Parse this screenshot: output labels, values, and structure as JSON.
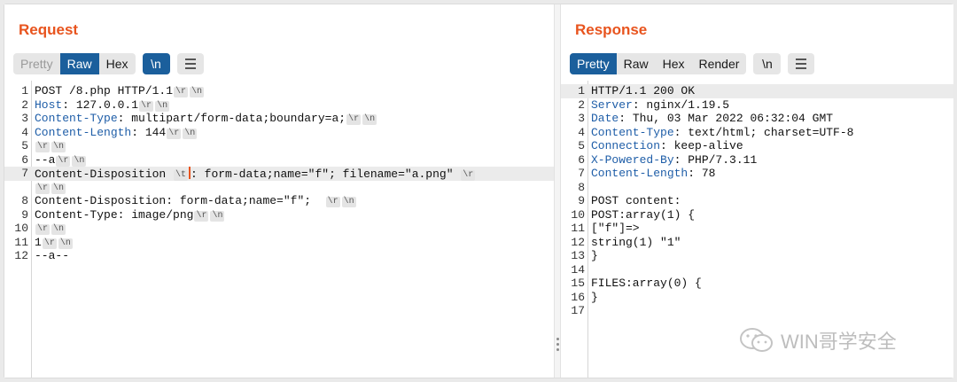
{
  "request": {
    "title": "Request",
    "tabs": [
      "Pretty",
      "Raw",
      "Hex"
    ],
    "active_tab": "Raw",
    "newline_button": "\\n",
    "lines": [
      {
        "n": "1",
        "segs": [
          {
            "t": "POST /8.php HTTP/1.1"
          },
          {
            "tag": "\\r"
          },
          {
            "tag": "\\n"
          }
        ]
      },
      {
        "n": "2",
        "segs": [
          {
            "k": "Host"
          },
          {
            "t": ": 127.0.0.1"
          },
          {
            "tag": "\\r"
          },
          {
            "tag": "\\n"
          }
        ]
      },
      {
        "n": "3",
        "segs": [
          {
            "k": "Content-Type"
          },
          {
            "t": ": multipart/form-data;boundary=a;"
          },
          {
            "tag": "\\r"
          },
          {
            "tag": "\\n"
          }
        ]
      },
      {
        "n": "4",
        "segs": [
          {
            "k": "Content-Length"
          },
          {
            "t": ": 144"
          },
          {
            "tag": "\\r"
          },
          {
            "tag": "\\n"
          }
        ]
      },
      {
        "n": "5",
        "segs": [
          {
            "tag": "\\r"
          },
          {
            "tag": "\\n"
          }
        ]
      },
      {
        "n": "6",
        "segs": [
          {
            "t": "--a"
          },
          {
            "tag": "\\r"
          },
          {
            "tag": "\\n"
          }
        ]
      },
      {
        "n": "7",
        "hl": true,
        "segs": [
          {
            "t": "Content-Disposition "
          },
          {
            "tag": "\\t"
          },
          {
            "caret": true
          },
          {
            "t": ": form-data;name=\"f\"; filename=\"a.png\" "
          },
          {
            "tag": "\\r"
          }
        ]
      },
      {
        "n": "",
        "hl": false,
        "segs": [
          {
            "tag": "\\r"
          },
          {
            "tag": "\\n"
          }
        ]
      },
      {
        "n": "8",
        "segs": [
          {
            "t": "Content-Disposition: form-data;name=\"f\";  "
          },
          {
            "tag": "\\r"
          },
          {
            "tag": "\\n"
          }
        ]
      },
      {
        "n": "9",
        "segs": [
          {
            "t": "Content-Type: image/png"
          },
          {
            "tag": "\\r"
          },
          {
            "tag": "\\n"
          }
        ]
      },
      {
        "n": "10",
        "segs": [
          {
            "tag": "\\r"
          },
          {
            "tag": "\\n"
          }
        ]
      },
      {
        "n": "11",
        "segs": [
          {
            "t": "1"
          },
          {
            "tag": "\\r"
          },
          {
            "tag": "\\n"
          }
        ]
      },
      {
        "n": "12",
        "segs": [
          {
            "t": "--a--"
          }
        ]
      }
    ]
  },
  "response": {
    "title": "Response",
    "tabs": [
      "Pretty",
      "Raw",
      "Hex",
      "Render"
    ],
    "active_tab": "Pretty",
    "newline_button": "\\n",
    "lines": [
      {
        "n": "1",
        "hl": true,
        "segs": [
          {
            "t": "HTTP/1.1 200 OK"
          }
        ]
      },
      {
        "n": "2",
        "segs": [
          {
            "k": "Server"
          },
          {
            "t": ": nginx/1.19.5"
          }
        ]
      },
      {
        "n": "3",
        "segs": [
          {
            "k": "Date"
          },
          {
            "t": ": Thu, 03 Mar 2022 06:32:04 GMT"
          }
        ]
      },
      {
        "n": "4",
        "segs": [
          {
            "k": "Content-Type"
          },
          {
            "t": ": text/html; charset=UTF-8"
          }
        ]
      },
      {
        "n": "5",
        "segs": [
          {
            "k": "Connection"
          },
          {
            "t": ": keep-alive"
          }
        ]
      },
      {
        "n": "6",
        "segs": [
          {
            "k": "X-Powered-By"
          },
          {
            "t": ": PHP/7.3.11"
          }
        ]
      },
      {
        "n": "7",
        "segs": [
          {
            "k": "Content-Length"
          },
          {
            "t": ": 78"
          }
        ]
      },
      {
        "n": "8",
        "segs": []
      },
      {
        "n": "9",
        "segs": [
          {
            "t": "POST content:"
          }
        ]
      },
      {
        "n": "10",
        "segs": [
          {
            "t": "POST:array(1) {"
          }
        ]
      },
      {
        "n": "11",
        "segs": [
          {
            "t": "[\"f\"]=>"
          }
        ]
      },
      {
        "n": "12",
        "segs": [
          {
            "t": "string(1) \"1\""
          }
        ]
      },
      {
        "n": "13",
        "segs": [
          {
            "t": "}"
          }
        ]
      },
      {
        "n": "14",
        "segs": []
      },
      {
        "n": "15",
        "segs": [
          {
            "t": "FILES:array(0) {"
          }
        ]
      },
      {
        "n": "16",
        "segs": [
          {
            "t": "}"
          }
        ]
      },
      {
        "n": "17",
        "segs": []
      }
    ]
  },
  "watermark": {
    "text": "WIN哥学安全",
    "icon": "wechat-logo-icon"
  },
  "colors": {
    "title": "#e8541e",
    "active_tab": "#1b5f9c",
    "header_key": "#1f5ea8",
    "highlight": "#ebebeb"
  }
}
